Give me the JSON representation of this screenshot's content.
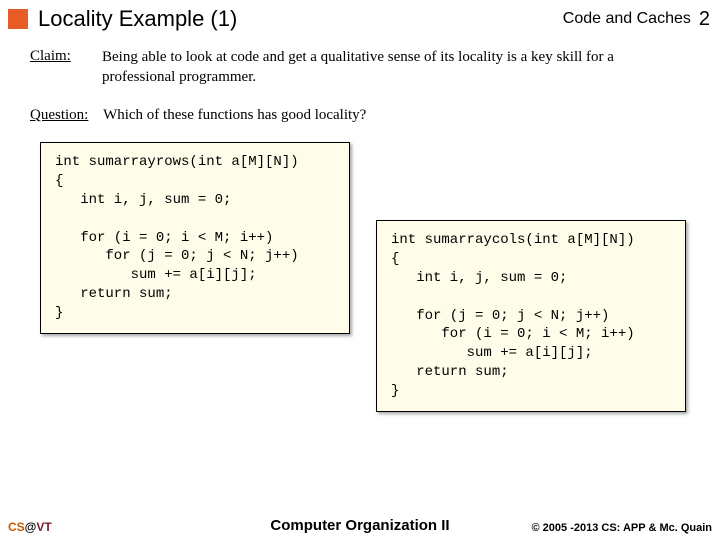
{
  "header": {
    "title": "Locality Example (1)",
    "subtitle": "Code and Caches",
    "page": "2"
  },
  "claim": {
    "label": "Claim:",
    "text": "Being able to look at code and get a qualitative sense of its locality is a key skill for a professional programmer."
  },
  "question": {
    "label": "Question:",
    "text": "Which of these functions has good locality?"
  },
  "code1": "int sumarrayrows(int a[M][N])\n{\n   int i, j, sum = 0;\n\n   for (i = 0; i < M; i++)\n      for (j = 0; j < N; j++)\n         sum += a[i][j];\n   return sum;\n}",
  "code2": "int sumarraycols(int a[M][N])\n{\n   int i, j, sum = 0;\n\n   for (j = 0; j < N; j++)\n      for (i = 0; i < M; i++)\n         sum += a[i][j];\n   return sum;\n}",
  "footer": {
    "left_cs": "CS",
    "left_at": "@",
    "left_vt": "VT",
    "center": "Computer Organization II",
    "right": "© 2005 -2013 CS: APP & Mc. Quain"
  }
}
